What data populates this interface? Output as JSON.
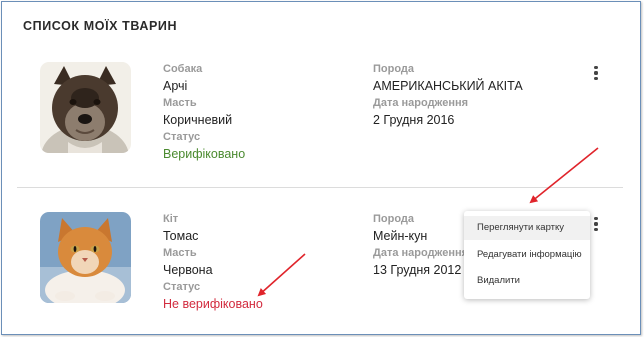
{
  "page": {
    "title": "СПИСОК МОЇХ ТВАРИН"
  },
  "pets": [
    {
      "species": "Собака",
      "name": "Арчі",
      "color_label": "Масть",
      "color": "Коричневий",
      "status_label": "Статус",
      "status": "Верифіковано",
      "breed_label": "Порода",
      "breed": "АМЕРИКАНСЬКИЙ АКІТА",
      "birth_label": "Дата народження",
      "birth": "2 Грудня 2016"
    },
    {
      "species": "Кіт",
      "name": "Томас",
      "color_label": "Масть",
      "color": "Червона",
      "status_label": "Статус",
      "status": "Не верифіковано",
      "breed_label": "Порода",
      "breed": "Мейн-кун",
      "birth_label": "Дата народження",
      "birth": "13 Грудня 2012"
    }
  ],
  "context_menu": {
    "items": [
      "Переглянути картку",
      "Редагувати інформацію",
      "Видалити"
    ]
  },
  "colors": {
    "verified": "#4a8a2f",
    "not_verified": "#d22b3e",
    "annotation_arrow": "#e0242b"
  },
  "icons": {
    "more": "kebab-vertical-icon"
  }
}
